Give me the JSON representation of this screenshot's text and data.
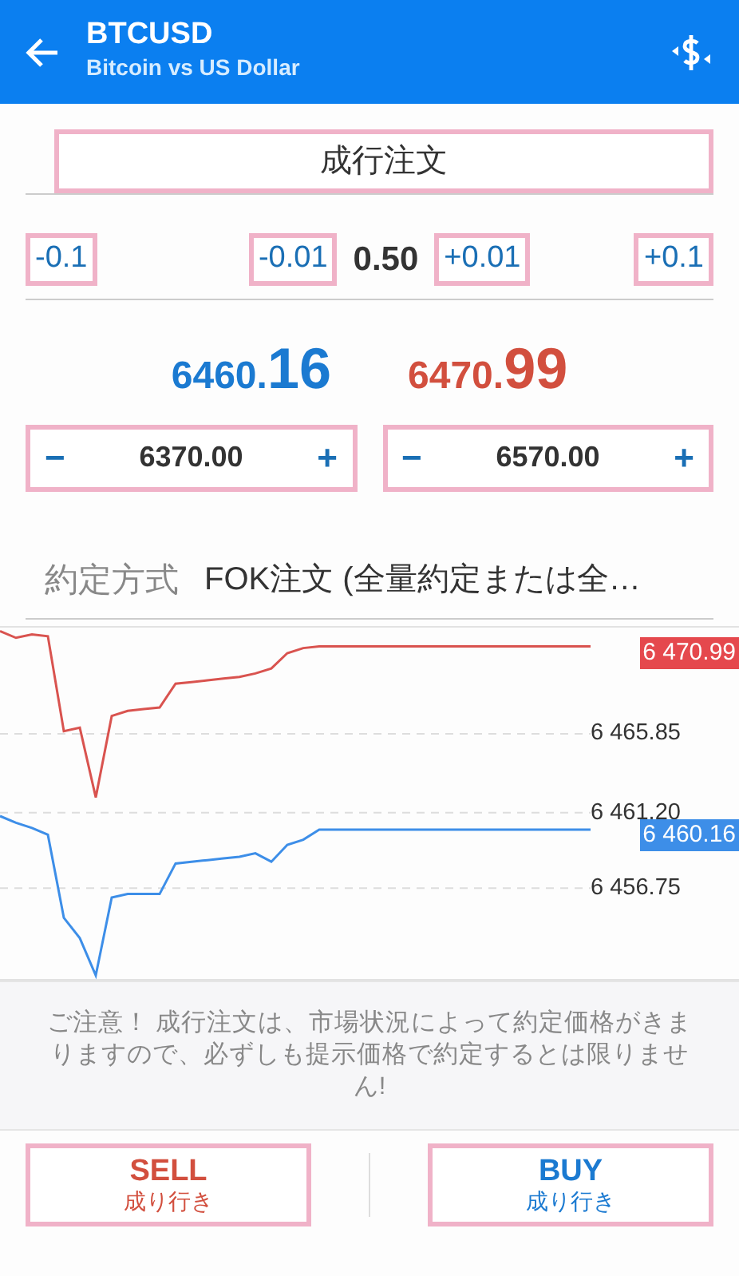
{
  "header": {
    "symbol": "BTCUSD",
    "description": "Bitcoin vs US Dollar"
  },
  "order_type": {
    "value": "成行注文"
  },
  "volume": {
    "steps": [
      {
        "label": "-0.1"
      },
      {
        "label": "-0.01"
      },
      {
        "label": "+0.01"
      },
      {
        "label": "+0.1"
      }
    ],
    "value": "0.50"
  },
  "quotes": [
    {
      "kind": "bid",
      "main": "6460.",
      "big": "16"
    },
    {
      "kind": "ask",
      "main": "6470.",
      "big": "99"
    }
  ],
  "levels": [
    {
      "minus": "−",
      "value": "6370.00",
      "plus": "+"
    },
    {
      "minus": "−",
      "value": "6570.00",
      "plus": "+"
    }
  ],
  "fill_policy": {
    "label": "約定方式",
    "value": "FOK注文 (全量約定または全…"
  },
  "chart": {
    "chart_data": {
      "type": "line",
      "categories": [
        null,
        null,
        null,
        null,
        null,
        null,
        null,
        null,
        null,
        null,
        null,
        null,
        null,
        null,
        null,
        null,
        null,
        null,
        null,
        null,
        null,
        null,
        null,
        null,
        null,
        null,
        null,
        null,
        null,
        null,
        null,
        null,
        null,
        null,
        null,
        null,
        null,
        null
      ],
      "grid": true,
      "ylim": [
        6451.3,
        6472.2
      ],
      "yticks": [
        {
          "value": 6465.85,
          "label": "6 465.85"
        },
        {
          "value": 6461.2,
          "label": "6 461.20"
        },
        {
          "value": 6456.75,
          "label": "6 456.75"
        }
      ],
      "series": [
        {
          "color": "#d9534f",
          "values": [
            6471.9,
            6471.5,
            6471.7,
            6471.6,
            6466.0,
            6466.2,
            6462.1,
            6466.9,
            6467.2,
            6467.3,
            6467.4,
            6468.8,
            6468.9,
            6469.0,
            6469.1,
            6469.2,
            6469.4,
            6469.7,
            6470.6,
            6470.9,
            6471.0,
            6471.0,
            6471.0,
            6471.0,
            6471.0,
            6471.0,
            6471.0,
            6471.0,
            6471.0,
            6471.0,
            6471.0,
            6471.0,
            6471.0,
            6471.0,
            6471.0,
            6471.0,
            6471.0,
            6471.0
          ]
        },
        {
          "color": "#3d8ee8",
          "values": [
            6461.0,
            6460.6,
            6460.3,
            6459.9,
            6455.0,
            6453.8,
            6451.6,
            6456.2,
            6456.4,
            6456.4,
            6456.4,
            6458.2,
            6458.3,
            6458.4,
            6458.5,
            6458.6,
            6458.8,
            6458.3,
            6459.3,
            6459.6,
            6460.2,
            6460.2,
            6460.2,
            6460.2,
            6460.2,
            6460.2,
            6460.2,
            6460.2,
            6460.2,
            6460.2,
            6460.2,
            6460.2,
            6460.2,
            6460.2,
            6460.2,
            6460.2,
            6460.2,
            6460.2
          ]
        }
      ]
    },
    "tags": [
      {
        "label": "6 470.99",
        "color": "#e5484d"
      },
      {
        "label": "6 460.16",
        "color": "#3d8ee8"
      }
    ]
  },
  "notice": "ご注意！ 成行注文は、市場状況によって約定価格がきまりますので、必ずしも提示価格で約定するとは限りません!",
  "actions": [
    {
      "kind": "sell",
      "label": "SELL",
      "sub": "成り行き"
    },
    {
      "kind": "buy",
      "label": "BUY",
      "sub": "成り行き"
    }
  ]
}
